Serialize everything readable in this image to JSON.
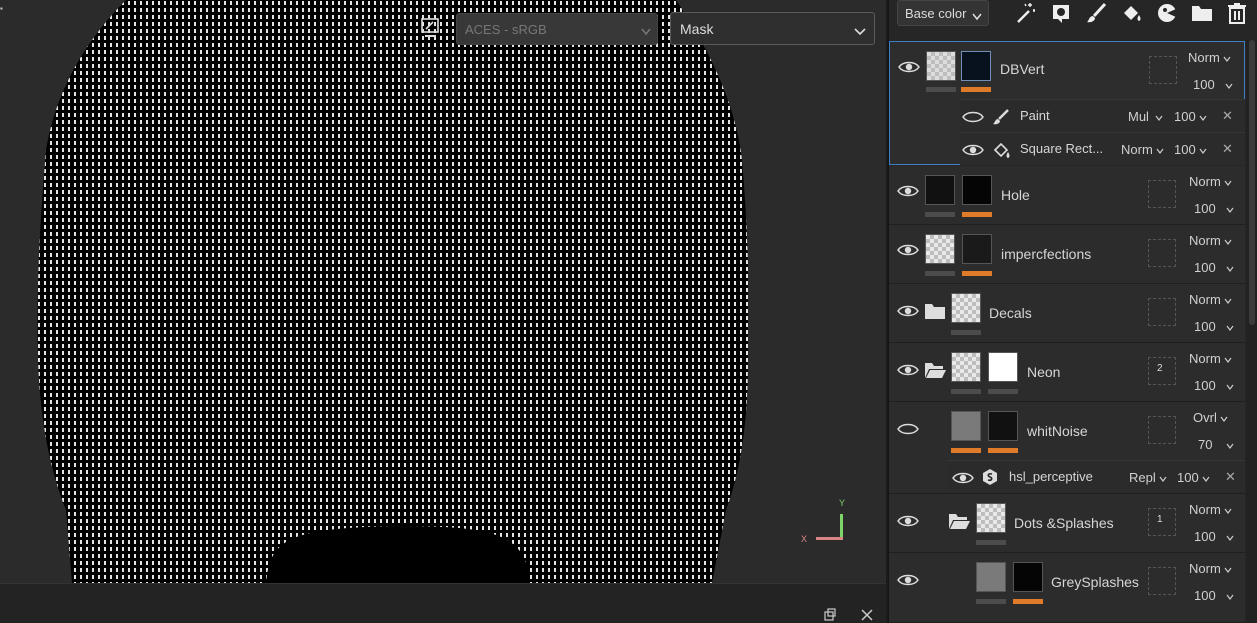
{
  "viewport": {
    "colorspace_label": "ACES - sRGB",
    "channel_label": "Mask",
    "gizmo": {
      "x_label": "X",
      "y_label": "Y"
    }
  },
  "toolbar": {
    "channel_select": "Base color",
    "icons": [
      "magic-wand-icon",
      "fill-refresh-icon",
      "brush-icon",
      "fill-bucket-icon",
      "smart-mask-icon",
      "folder-icon",
      "trash-icon"
    ]
  },
  "layers": [
    {
      "name": "DBVert",
      "blend": "Norm",
      "opacity": "100",
      "effects": [
        {
          "name": "Paint",
          "blend": "Mul",
          "opacity": "100"
        },
        {
          "name": "Square Rect...",
          "blend": "Norm",
          "opacity": "100"
        }
      ]
    },
    {
      "name": "Hole",
      "blend": "Norm",
      "opacity": "100"
    },
    {
      "name": "impercfections",
      "blend": "Norm",
      "opacity": "100"
    },
    {
      "name": "Decals",
      "blend": "Norm",
      "opacity": "100"
    },
    {
      "name": "Neon",
      "blend": "Norm",
      "opacity": "100",
      "count": "2"
    },
    {
      "name": "whitNoise",
      "blend": "Ovrl",
      "opacity": "70",
      "effects": [
        {
          "name": "hsl_perceptive",
          "blend": "Repl",
          "opacity": "100"
        }
      ]
    },
    {
      "name": "Dots &Splashes",
      "blend": "Norm",
      "opacity": "100",
      "count": "1"
    },
    {
      "name": "GreySplashes",
      "blend": "Norm",
      "opacity": "100"
    }
  ],
  "colors": {
    "accent": "#3c7fc6",
    "mask_tag": "#e07b2a",
    "panel_bg": "#262626"
  }
}
